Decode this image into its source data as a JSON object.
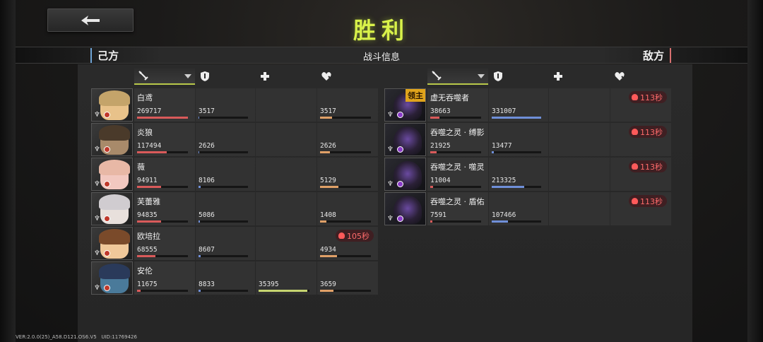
{
  "title": "胜利",
  "header": {
    "left_side": "己方",
    "center": "战斗信息",
    "right_side": "敌方"
  },
  "footer": {
    "version": "VER:2.0.0(25)_A58.D121.OS6.V5",
    "uid": "UID:11769426"
  },
  "columns": [
    "damage-icon",
    "shield-icon",
    "heal-icon",
    "damage-taken-icon"
  ],
  "allies": [
    {
      "name": "白鸢",
      "damage": "269717",
      "damage_pct": 1.0,
      "def": "3517",
      "def_pct": 0.02,
      "heal": "",
      "heal_pct": 0,
      "taken": "3517",
      "taken_pct": 0.24,
      "timer": "",
      "colors": [
        "#e8c28a",
        "#c4a46a"
      ]
    },
    {
      "name": "炎狼",
      "damage": "117494",
      "damage_pct": 0.58,
      "def": "2626",
      "def_pct": 0.02,
      "heal": "",
      "heal_pct": 0,
      "taken": "2626",
      "taken_pct": 0.2,
      "timer": "",
      "colors": [
        "#a88a6a",
        "#4a3a2a"
      ]
    },
    {
      "name": "薇",
      "damage": "94911",
      "damage_pct": 0.47,
      "def": "8106",
      "def_pct": 0.04,
      "heal": "",
      "heal_pct": 0,
      "taken": "5129",
      "taken_pct": 0.36,
      "timer": "",
      "colors": [
        "#f2c8c0",
        "#e8b8a6"
      ]
    },
    {
      "name": "芙蕾雅",
      "damage": "94835",
      "damage_pct": 0.47,
      "def": "5086",
      "def_pct": 0.03,
      "heal": "",
      "heal_pct": 0,
      "taken": "1408",
      "taken_pct": 0.12,
      "timer": "",
      "colors": [
        "#e8e0dc",
        "#d0ccd0"
      ]
    },
    {
      "name": "欧培拉",
      "damage": "68555",
      "damage_pct": 0.36,
      "def": "8607",
      "def_pct": 0.04,
      "heal": "",
      "heal_pct": 0,
      "taken": "4934",
      "taken_pct": 0.34,
      "timer": "105秒",
      "colors": [
        "#f0c89a",
        "#7a4a2a"
      ]
    },
    {
      "name": "安伦",
      "damage": "11675",
      "damage_pct": 0.07,
      "def": "8833",
      "def_pct": 0.04,
      "heal": "35395",
      "heal_pct": 0.96,
      "taken": "3659",
      "taken_pct": 0.26,
      "timer": "",
      "colors": [
        "#4a7a9a",
        "#2a3a5a"
      ]
    }
  ],
  "enemies": [
    {
      "name": "虚无吞噬者",
      "boss_tag": "领主",
      "damage": "38663",
      "damage_pct": 0.18,
      "def": "331007",
      "def_pct": 1.0,
      "timer": "113秒"
    },
    {
      "name": "吞噬之灵 · 缚影",
      "boss_tag": "",
      "damage": "21925",
      "damage_pct": 0.12,
      "def": "13477",
      "def_pct": 0.04,
      "timer": "113秒"
    },
    {
      "name": "吞噬之灵 · 噬灵",
      "boss_tag": "",
      "damage": "11004",
      "damage_pct": 0.06,
      "def": "213325",
      "def_pct": 0.66,
      "timer": "113秒"
    },
    {
      "name": "吞噬之灵 · 盾佑",
      "boss_tag": "",
      "damage": "7591",
      "damage_pct": 0.04,
      "def": "107466",
      "def_pct": 0.33,
      "timer": "113秒"
    }
  ]
}
